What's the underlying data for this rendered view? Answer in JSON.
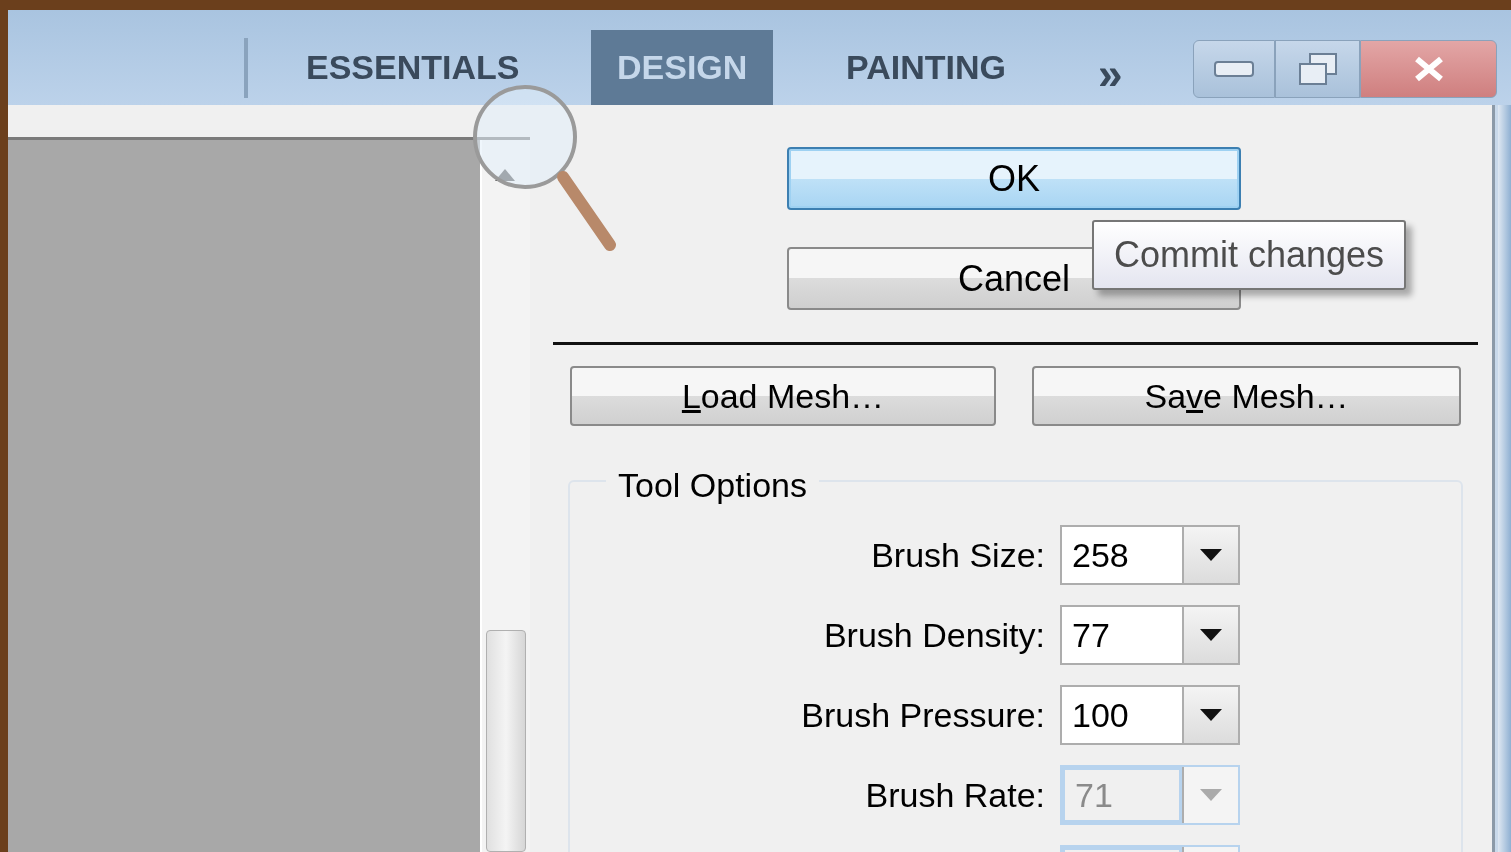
{
  "workspace_bar": {
    "tabs": [
      {
        "label": "ESSENTIALS",
        "selected": false
      },
      {
        "label": "DESIGN",
        "selected": true
      },
      {
        "label": "PAINTING",
        "selected": false
      }
    ],
    "more": "»"
  },
  "dialog": {
    "buttons": [
      {
        "label": "OK",
        "default": true
      },
      {
        "label": "Cancel",
        "default": false
      }
    ],
    "tooltip": "Commit changes",
    "mesh_buttons": [
      {
        "key": "L",
        "after": "oad Mesh…"
      },
      {
        "before": "Sa",
        "key": "v",
        "after": "e Mesh…"
      }
    ],
    "tool_options": {
      "title": "Tool Options",
      "fields": [
        {
          "label": "Brush Size:",
          "value": "258",
          "disabled": false
        },
        {
          "label": "Brush Density:",
          "value": "77",
          "disabled": false
        },
        {
          "label": "Brush Pressure:",
          "value": "100",
          "disabled": false
        },
        {
          "label": "Brush Rate:",
          "value": "71",
          "disabled": true
        },
        {
          "disabled": true
        }
      ]
    }
  }
}
